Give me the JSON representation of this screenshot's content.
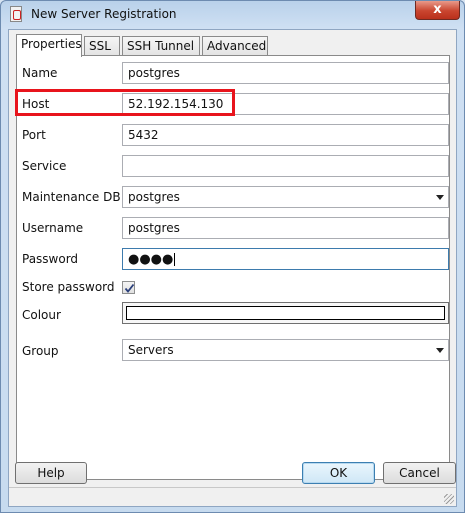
{
  "window": {
    "title": "New Server Registration",
    "close_glyph": "x"
  },
  "tabs": [
    {
      "label": "Properties",
      "active": true
    },
    {
      "label": "SSL",
      "active": false
    },
    {
      "label": "SSH Tunnel",
      "active": false
    },
    {
      "label": "Advanced",
      "active": false
    }
  ],
  "form": {
    "name": {
      "label": "Name",
      "value": "postgres"
    },
    "host": {
      "label": "Host",
      "value": "52.192.154.130"
    },
    "port": {
      "label": "Port",
      "value": "5432"
    },
    "service": {
      "label": "Service",
      "value": ""
    },
    "maintenance_db": {
      "label": "Maintenance DB",
      "value": "postgres"
    },
    "username": {
      "label": "Username",
      "value": "postgres"
    },
    "password": {
      "label": "Password",
      "masked_value": "●●●●"
    },
    "store_password": {
      "label": "Store password",
      "checked": true
    },
    "colour": {
      "label": "Colour",
      "value_color": "#ffffff"
    },
    "group": {
      "label": "Group",
      "value": "Servers"
    }
  },
  "annotation": {
    "highlight_color": "#e8141c",
    "highlighted_field": "host"
  },
  "buttons": {
    "help": "Help",
    "ok": "OK",
    "cancel": "Cancel"
  },
  "colors": {
    "accent": "#3c7fb1",
    "window_chrome": "#b9d1ea",
    "close_button": "#c9452f"
  }
}
